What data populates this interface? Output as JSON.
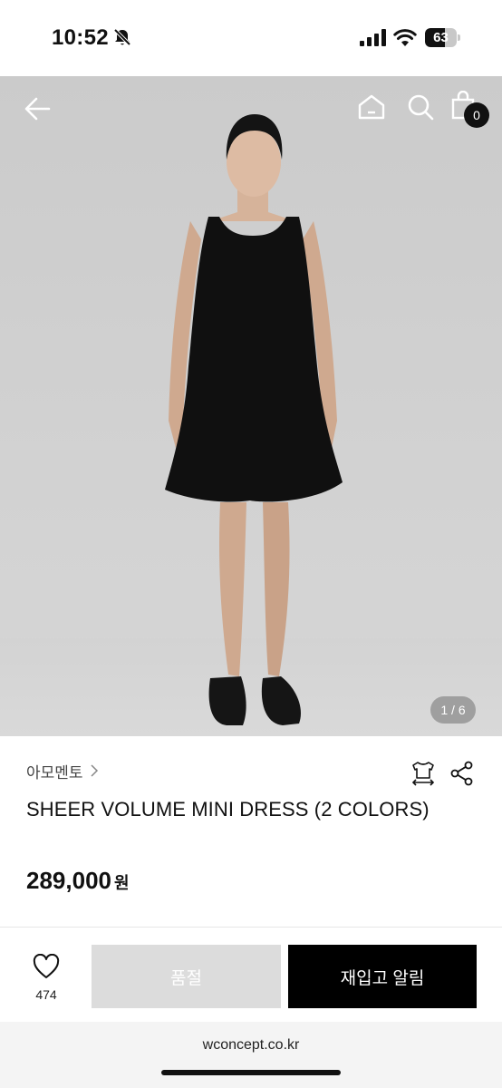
{
  "status_bar": {
    "time": "10:52",
    "battery": "63",
    "battery_level": 0.63
  },
  "header": {
    "cart_count": "0"
  },
  "gallery": {
    "pager": "1 / 6"
  },
  "product": {
    "brand": "아모멘토",
    "title": "SHEER VOLUME MINI DRESS (2 COLORS)",
    "price": "289,000",
    "currency": "원"
  },
  "actions": {
    "like_count": "474",
    "soldout_label": "품절",
    "restock_label": "재입고 알림"
  },
  "browser": {
    "url": "wconcept.co.kr"
  },
  "colors": {
    "accent": "#000000",
    "disabled": "#dcdcdc"
  }
}
